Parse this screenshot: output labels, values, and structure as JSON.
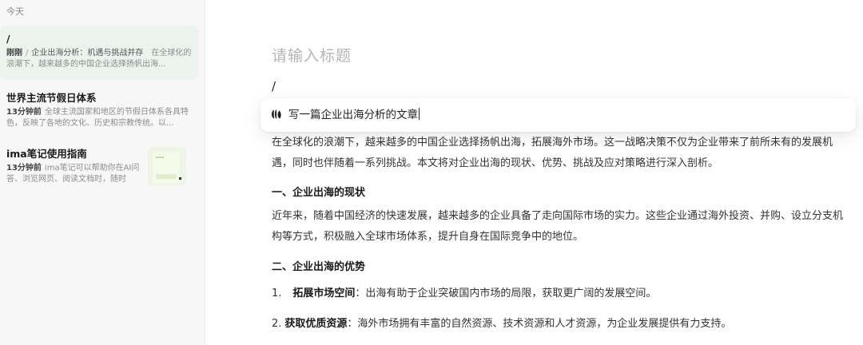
{
  "sidebar": {
    "group_label": "今天",
    "notes": [
      {
        "title": "/",
        "time": "刚刚",
        "separator": "/",
        "heading": "企业出海分析：机遇与挑战并存",
        "snippet": "在全球化的浪潮下，越来越多的中国企业选择扬帆出海..."
      },
      {
        "title": "世界主流节假日体系",
        "time": "13分钟前",
        "snippet": "全球主流国家和地区的节假日体系各具特色，反映了各地的文化、历史和宗教传统。以..."
      },
      {
        "title": "ima笔记使用指南",
        "time": "13分钟前",
        "snippet": "ima笔记可以帮助你在AI问答、浏览网页、阅读文档时，随时随..."
      }
    ]
  },
  "editor": {
    "title_placeholder": "请输入标题",
    "slash": "/",
    "ai_prompt": "写一篇企业出海分析的文章",
    "content": {
      "intro": "在全球化的浪潮下，越来越多的中国企业选择扬帆出海，拓展海外市场。这一战略决策不仅为企业带来了前所未有的发展机遇，同时也伴随着一系列挑战。本文将对企业出海的现状、优势、挑战及应对策略进行深入剖析。",
      "heading1": "一、企业出海的现状",
      "para1": "近年来，随着中国经济的快速发展，越来越多的企业具备了走向国际市场的实力。这些企业通过海外投资、并购、设立分支机构等方式，积极融入全球市场体系，提升自身在国际竞争中的地位。",
      "heading2": "二、企业出海的优势",
      "item1_num": "1.",
      "item1_label": "拓展市场空间",
      "item1_text": "：出海有助于企业突破国内市场的局限，获取更广阔的发展空间。",
      "item2_num": "2.",
      "item2_label": "获取优质资源",
      "item2_text": "：海外市场拥有丰富的自然资源、技术资源和人才资源，为企业发展提供有力支持。"
    }
  },
  "colors": {
    "active_note_bg": "#ebf3ee",
    "sidebar_bg": "#f7f7f7",
    "placeholder": "#b5b5b5"
  },
  "icons": {
    "ai": "ai-sparkle-icon"
  }
}
